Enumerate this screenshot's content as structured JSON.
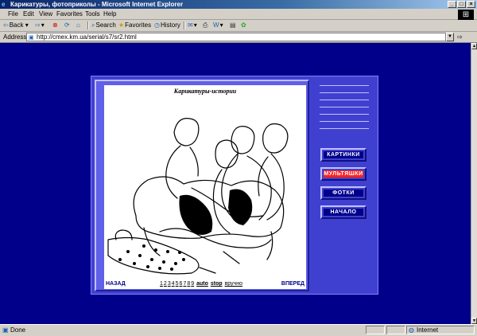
{
  "window": {
    "title": "Карикатуры, фотоприколы - Microsoft Internet Explorer",
    "controls": [
      "_",
      "□",
      "×"
    ]
  },
  "menubar": {
    "items": [
      "File",
      "Edit",
      "View",
      "Favorites",
      "Tools",
      "Help"
    ]
  },
  "toolbar": {
    "back": "Back",
    "search": "Search",
    "favorites": "Favorites",
    "history": "History"
  },
  "address": {
    "label": "Address",
    "url": "http://cmex.km.ua/serial/s7/sr2.html"
  },
  "page": {
    "cartoon_title": "Карикатуры-истории",
    "nav": {
      "back": "НАЗАД",
      "forward": "ВПЕРЕД",
      "pages": [
        "1",
        "2",
        "3",
        "4",
        "5",
        "6",
        "7",
        "8",
        "9"
      ],
      "auto": "auto",
      "stop": "stop",
      "manual": "вручно"
    },
    "menu": [
      "КАРТИНКИ",
      "МУЛЬТЯШКИ",
      "ФОТКИ",
      "НАЧАЛО"
    ]
  },
  "status": {
    "text": "Done",
    "zone": "Internet"
  },
  "colors": {
    "page_bg": "#00008b",
    "active_button": "#ff2020"
  }
}
